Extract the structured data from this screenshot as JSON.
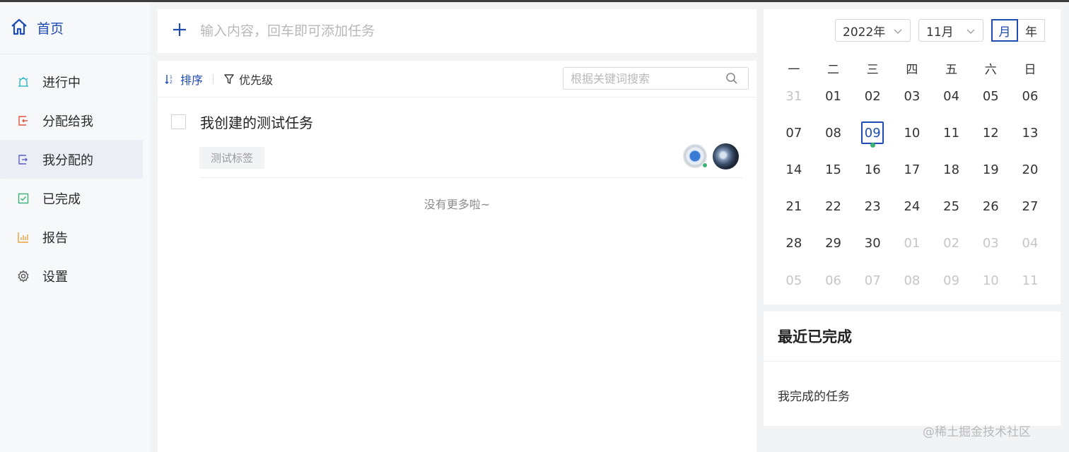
{
  "sidebar": {
    "home_label": "首页",
    "items": [
      {
        "label": "进行中",
        "icon": "alarm-icon",
        "color": "#2bb6c6"
      },
      {
        "label": "分配给我",
        "icon": "assigned-in-icon",
        "color": "#e0533f"
      },
      {
        "label": "我分配的",
        "icon": "assigned-out-icon",
        "color": "#5b5fc7"
      },
      {
        "label": "已完成",
        "icon": "check-square-icon",
        "color": "#3bb273"
      },
      {
        "label": "报告",
        "icon": "bar-chart-icon",
        "color": "#e8a33b"
      },
      {
        "label": "设置",
        "icon": "gear-icon",
        "color": "#555555"
      }
    ]
  },
  "add_task": {
    "placeholder": "输入内容，回车即可添加任务"
  },
  "toolbar": {
    "sort_label": "排序",
    "priority_label": "优先级",
    "search_placeholder": "根据关键词搜索"
  },
  "tasks": [
    {
      "title": "我创建的测试任务",
      "tag": "测试标签"
    }
  ],
  "no_more": "没有更多啦~",
  "calendar": {
    "year": "2022年",
    "month": "11月",
    "view_month": "月",
    "view_year": "年",
    "weekdays": [
      "一",
      "二",
      "三",
      "四",
      "五",
      "六",
      "日"
    ],
    "days": [
      "31",
      "01",
      "02",
      "03",
      "04",
      "05",
      "06",
      "07",
      "08",
      "09",
      "10",
      "11",
      "12",
      "13",
      "14",
      "15",
      "16",
      "17",
      "18",
      "19",
      "20",
      "21",
      "22",
      "23",
      "24",
      "25",
      "26",
      "27",
      "28",
      "29",
      "30",
      "01",
      "02",
      "03",
      "04",
      "05",
      "06",
      "07",
      "08",
      "09",
      "10",
      "11"
    ],
    "muted": [
      0,
      31,
      32,
      33,
      34,
      35,
      36,
      37,
      38,
      39,
      40,
      41
    ],
    "today_index": 9,
    "marked_index": 9
  },
  "recent": {
    "title": "最近已完成",
    "items": [
      "我完成的任务"
    ]
  },
  "watermark": "@稀土掘金技术社区",
  "colors": {
    "accent": "#1f4bb5",
    "success": "#3bb273"
  }
}
